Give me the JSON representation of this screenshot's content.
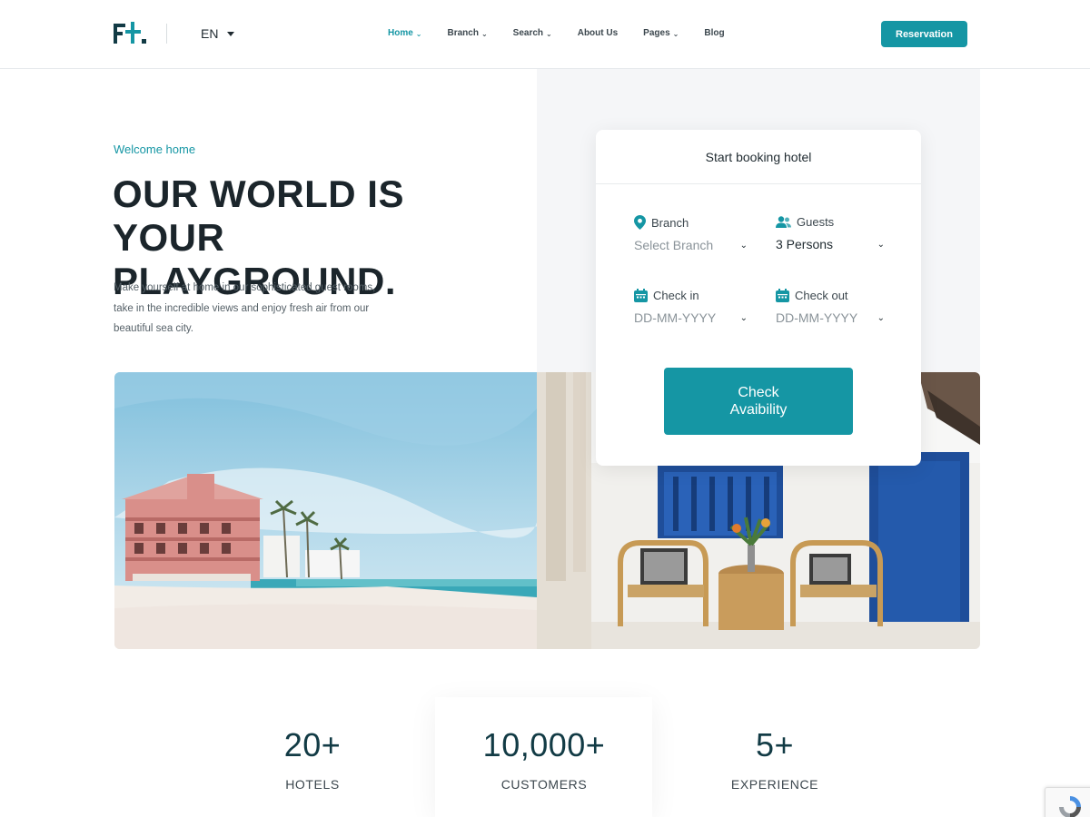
{
  "header": {
    "language": "EN",
    "nav": [
      {
        "label": "Home",
        "dropdown": true,
        "active": true
      },
      {
        "label": "Branch",
        "dropdown": true,
        "active": false
      },
      {
        "label": "Search",
        "dropdown": true,
        "active": false
      },
      {
        "label": "About Us",
        "dropdown": false,
        "active": false
      },
      {
        "label": "Pages",
        "dropdown": true,
        "active": false
      },
      {
        "label": "Blog",
        "dropdown": false,
        "active": false
      }
    ],
    "reservation_label": "Reservation"
  },
  "hero": {
    "welcome": "Welcome home",
    "title_line1": "OUR WORLD IS YOUR",
    "title_line2": "PLAYGROUND.",
    "description": "Make yourself at home in our sophisticated guest rooms, take in the incredible views and enjoy fresh air from our beautiful sea city."
  },
  "booking": {
    "title": "Start booking hotel",
    "branch": {
      "label": "Branch",
      "placeholder": "Select Branch",
      "icon": "location-pin-icon"
    },
    "guests": {
      "label": "Guests",
      "value": "3 Persons",
      "icon": "users-icon"
    },
    "check_in": {
      "label": "Check in",
      "placeholder": "DD-MM-YYYY",
      "icon": "calendar-icon"
    },
    "check_out": {
      "label": "Check out",
      "placeholder": "DD-MM-YYYY",
      "icon": "calendar-icon"
    },
    "button_line1": "Check",
    "button_line2": "Avaibility"
  },
  "stats": [
    {
      "number": "20+",
      "label": "HOTELS"
    },
    {
      "number": "10,000+",
      "label": "CUSTOMERS"
    },
    {
      "number": "5+",
      "label": "EXPERIENCE"
    }
  ],
  "colors": {
    "accent": "#1596a4",
    "dark": "#1b252b"
  }
}
